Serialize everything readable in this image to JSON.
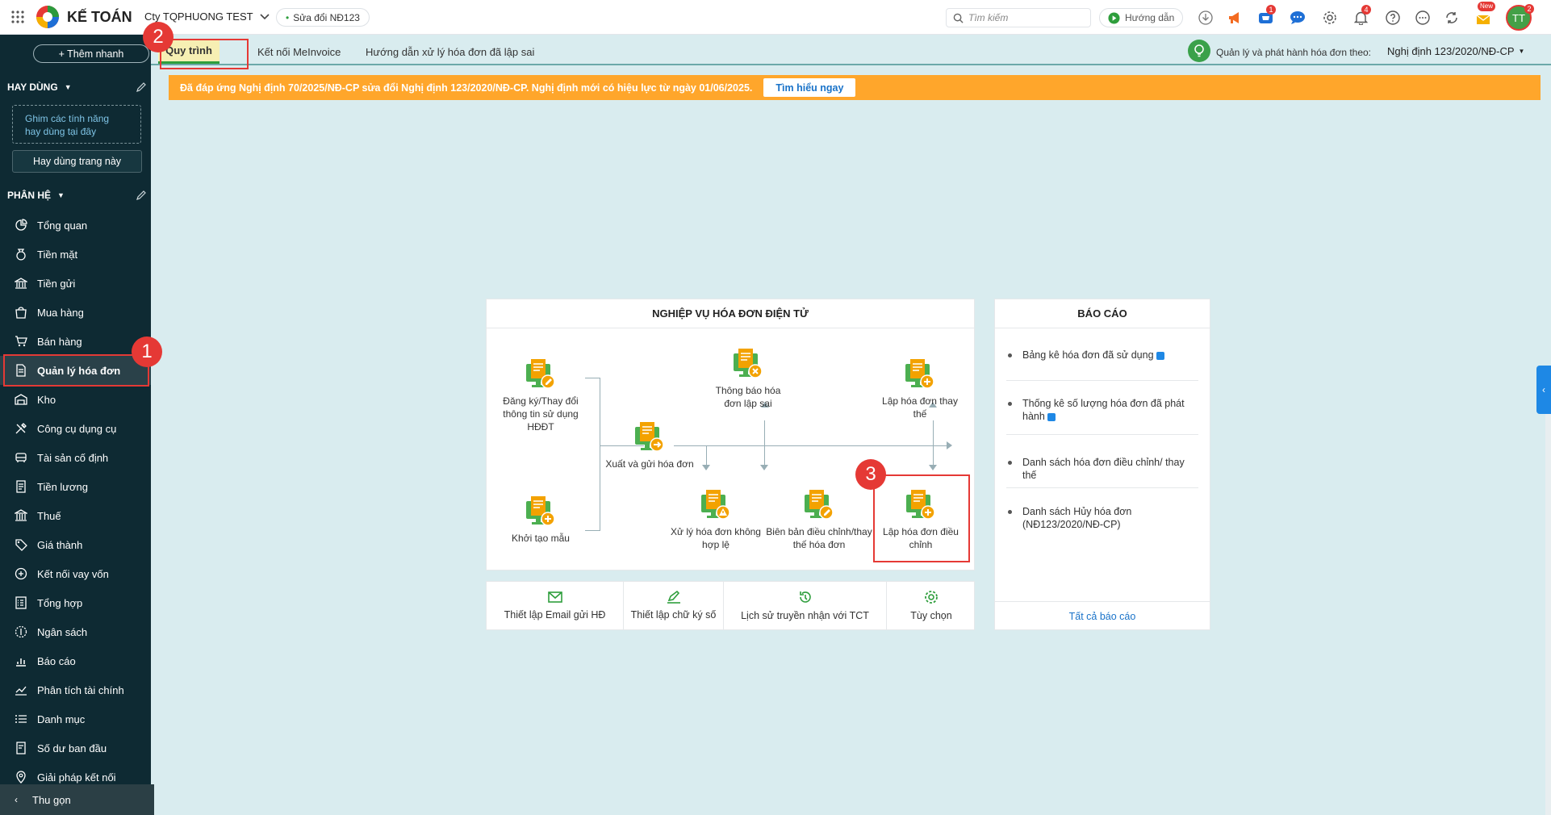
{
  "topbar": {
    "app_name": "KẾ TOÁN",
    "company": "Cty TQPHUONG TEST",
    "edit_chip": "Sửa đổi NĐ123",
    "search_placeholder": "Tìm kiếm",
    "guide_label": "Hướng dẫn",
    "cart_badge": "1",
    "notif_badge": "4",
    "new_badge": "New",
    "avatar_initials": "TT",
    "avatar_badge": "2"
  },
  "sidebar": {
    "quick_add": "+ Thêm nhanh",
    "favorites_header": "HAY DÙNG",
    "pin_hint_line1": "Ghim các tính năng",
    "pin_hint_line2": "hay dùng tại đây",
    "favorite_page_button": "Hay dùng trang này",
    "modules_header": "PHÂN HỆ",
    "items": [
      {
        "label": "Tổng quan",
        "icon": "dashboard-icon"
      },
      {
        "label": "Tiền mặt",
        "icon": "cash-bag-icon"
      },
      {
        "label": "Tiền gửi",
        "icon": "bank-icon"
      },
      {
        "label": "Mua hàng",
        "icon": "shopping-bag-icon"
      },
      {
        "label": "Bán hàng",
        "icon": "cart-icon"
      },
      {
        "label": "Quản lý hóa đơn",
        "icon": "invoice-icon"
      },
      {
        "label": "Kho",
        "icon": "warehouse-icon"
      },
      {
        "label": "Công cụ dụng cụ",
        "icon": "tools-icon"
      },
      {
        "label": "Tài sản cố định",
        "icon": "car-icon"
      },
      {
        "label": "Tiền lương",
        "icon": "salary-icon"
      },
      {
        "label": "Thuế",
        "icon": "tax-icon"
      },
      {
        "label": "Giá thành",
        "icon": "price-tag-icon"
      },
      {
        "label": "Kết nối vay vốn",
        "icon": "loan-icon"
      },
      {
        "label": "Tổng hợp",
        "icon": "summary-icon"
      },
      {
        "label": "Ngân sách",
        "icon": "budget-icon"
      },
      {
        "label": "Báo cáo",
        "icon": "report-chart-icon"
      },
      {
        "label": "Phân tích tài chính",
        "icon": "analytics-icon"
      },
      {
        "label": "Danh mục",
        "icon": "list-icon"
      },
      {
        "label": "Số dư ban đầu",
        "icon": "balance-icon"
      },
      {
        "label": "Giải pháp kết nối",
        "icon": "location-pin-icon"
      }
    ],
    "collapse_label": "Thu gọn"
  },
  "tabs": [
    {
      "label": "Quy trình"
    },
    {
      "label": "Kết nối MeInvoice"
    },
    {
      "label": "Hướng dẫn xử lý hóa đơn đã lập sai"
    }
  ],
  "regulation": {
    "label": "Quản lý và phát hành hóa đơn theo:",
    "value": "Nghị định 123/2020/NĐ-CP"
  },
  "banner": {
    "text": "Đã đáp ứng Nghị định 70/2025/NĐ-CP sửa đổi Nghị định 123/2020/NĐ-CP. Nghị định mới có hiệu lực từ ngày 01/06/2025.",
    "button": "Tìm hiểu ngay"
  },
  "process": {
    "title": "NGHIỆP VỤ HÓA ĐƠN ĐIỆN TỬ",
    "nodes": {
      "register": "Đăng ký/Thay đổi thông tin sử dụng HĐĐT",
      "template": "Khởi tạo mẫu",
      "issue": "Xuất và gửi hóa đơn",
      "error_notice": "Thông báo hóa đơn lập sai",
      "replace": "Lập hóa đơn thay thế",
      "invalid": "Xử lý hóa đơn không hợp lệ",
      "minutes": "Biên bản điều chỉnh/thay thế hóa đơn",
      "adjust": "Lập hóa đơn điều chỉnh"
    }
  },
  "actions": [
    {
      "label": "Thiết lập Email gửi HĐ",
      "icon": "email-icon"
    },
    {
      "label": "Thiết lập chữ ký số",
      "icon": "signature-icon"
    },
    {
      "label": "Lịch sử truyền nhận với TCT",
      "icon": "history-icon"
    },
    {
      "label": "Tùy chọn",
      "icon": "gear-icon"
    }
  ],
  "reports": {
    "title": "BÁO CÁO",
    "items": [
      "Bảng kê hóa đơn đã sử dụng",
      "Thống kê số lượng hóa đơn đã phát hành",
      "Danh sách hóa đơn điều chỉnh/ thay thế",
      "Danh sách Hủy hóa đơn (NĐ123/2020/NĐ-CP)"
    ],
    "all_link": "Tất cả báo cáo"
  },
  "markers": [
    "1",
    "2",
    "3"
  ],
  "colors": {
    "sidebar_bg": "#0e2a33",
    "accent_green": "#2e9e3c",
    "banner_orange": "#ffa62b",
    "link_blue": "#1a73c9",
    "highlight_red": "#e53935",
    "icon_orange": "#f3a200"
  }
}
